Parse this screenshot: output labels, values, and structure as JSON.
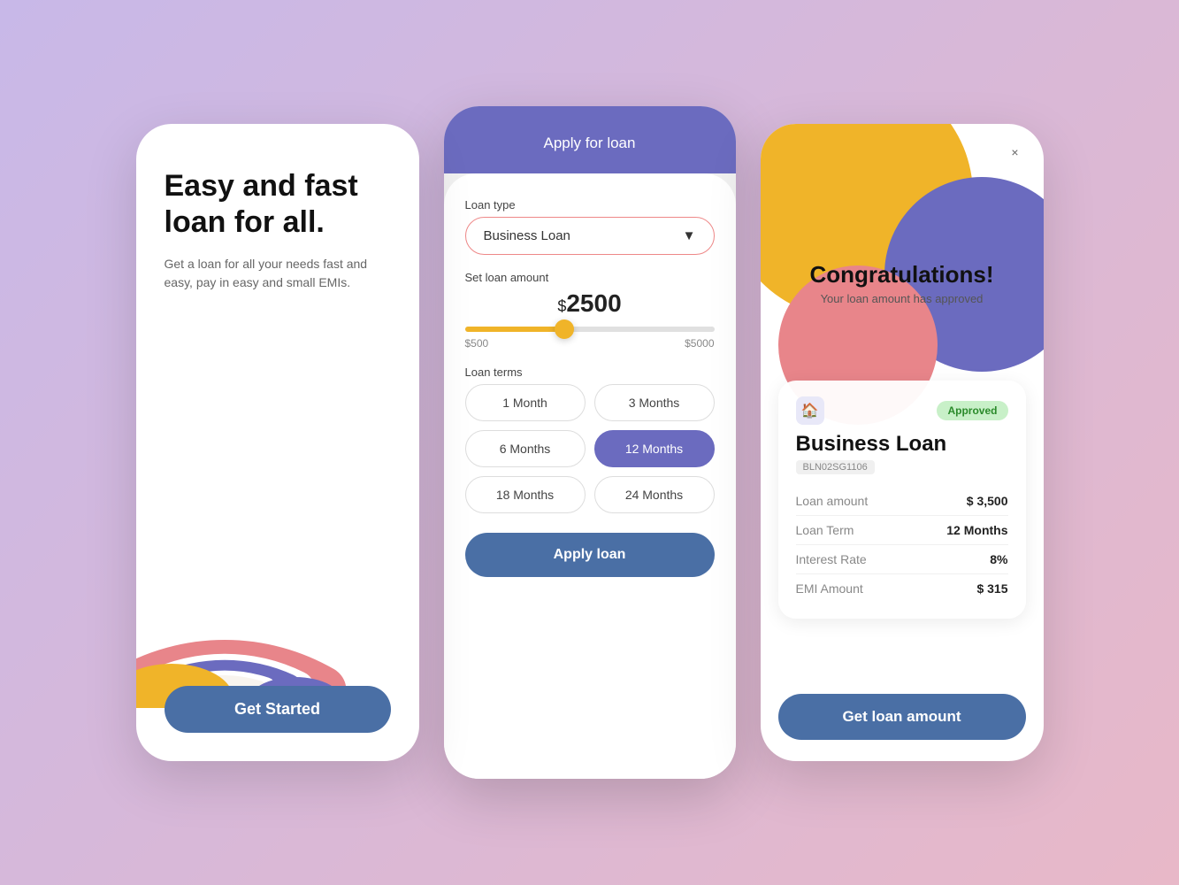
{
  "background": {
    "gradient_start": "#c8b8e8",
    "gradient_end": "#e8b8c8"
  },
  "screen1": {
    "title": "Easy and fast loan for all.",
    "subtitle": "Get a loan for all your needs fast and easy, pay in easy and small EMIs.",
    "cta_label": "Get Started"
  },
  "screen2": {
    "header_title": "Apply for loan",
    "loan_type_label": "Loan type",
    "loan_type_value": "Business Loan",
    "set_amount_label": "Set loan amount",
    "amount_value": "2500",
    "amount_symbol": "$",
    "slider_min": "$500",
    "slider_max": "$5000",
    "loan_terms_label": "Loan terms",
    "terms": [
      {
        "label": "1 Month",
        "active": false
      },
      {
        "label": "3 Months",
        "active": false
      },
      {
        "label": "6 Months",
        "active": false
      },
      {
        "label": "12 Months",
        "active": true
      },
      {
        "label": "18 Months",
        "active": false
      },
      {
        "label": "24 Months",
        "active": false
      }
    ],
    "apply_btn_label": "Apply loan"
  },
  "screen3": {
    "close_icon": "×",
    "congrats_title": "Congratulations!",
    "congrats_subtitle": "Your loan amount has approved",
    "approved_badge": "Approved",
    "loan_name": "Business Loan",
    "loan_id": "BLN02SG1106",
    "loan_icon": "🏠",
    "details": [
      {
        "label": "Loan amount",
        "value": "$ 3,500"
      },
      {
        "label": "Loan Term",
        "value": "12 Months"
      },
      {
        "label": "Interest Rate",
        "value": "8%"
      },
      {
        "label": "EMI Amount",
        "value": "$ 315"
      }
    ],
    "cta_label": "Get loan amount"
  }
}
